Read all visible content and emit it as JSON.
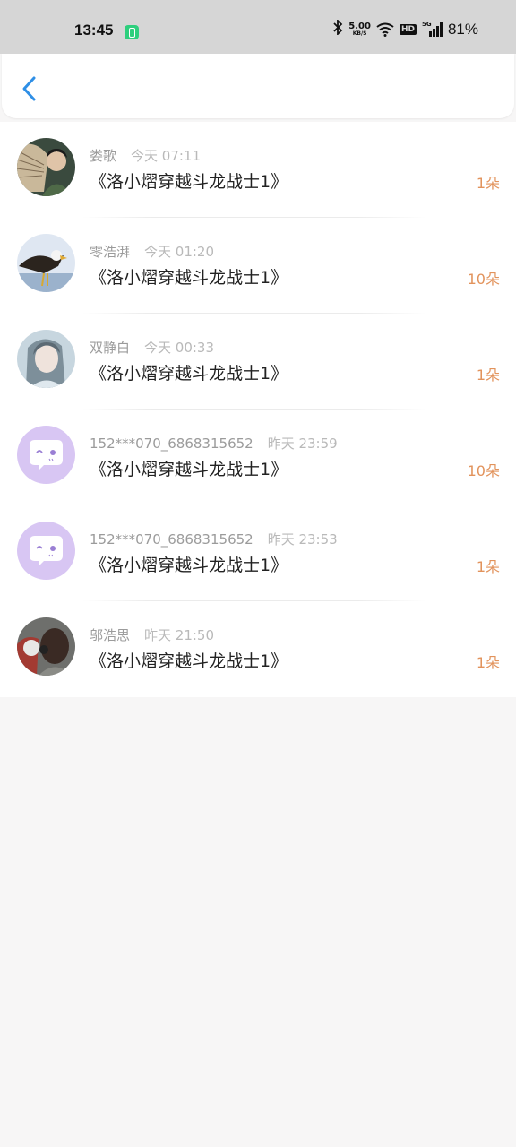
{
  "status_bar": {
    "time": "13:45",
    "net_speed_value": "5.00",
    "net_speed_unit": "KB/S",
    "hd_label": "HD",
    "signal_label": "5G",
    "battery": "81%"
  },
  "header": {
    "back_icon": "chevron-left-icon",
    "accent_color": "#2f8fe6"
  },
  "records": [
    {
      "name": "娄歌",
      "time": "今天 07:11",
      "title": "《洛小熠穿越斗龙战士1》",
      "count": "1朵",
      "avatar": "photo-woman-fan"
    },
    {
      "name": "零浩湃",
      "time": "今天 01:20",
      "title": "《洛小熠穿越斗龙战士1》",
      "count": "10朵",
      "avatar": "photo-eagle"
    },
    {
      "name": "双静白",
      "time": "今天 00:33",
      "title": "《洛小熠穿越斗龙战士1》",
      "count": "1朵",
      "avatar": "photo-girl"
    },
    {
      "name": "152***070_6868315652",
      "time": "昨天 23:59",
      "title": "《洛小熠穿越斗龙战士1》",
      "count": "10朵",
      "avatar": "default-chat-bubble"
    },
    {
      "name": "152***070_6868315652",
      "time": "昨天 23:53",
      "title": "《洛小熠穿越斗龙战士1》",
      "count": "1朵",
      "avatar": "default-chat-bubble"
    },
    {
      "name": "邬浩思",
      "time": "昨天 21:50",
      "title": "《洛小熠穿越斗龙战士1》",
      "count": "1朵",
      "avatar": "photo-headphones"
    }
  ],
  "colors": {
    "count": "#e2935c",
    "default_avatar": "#d8c6f3"
  }
}
